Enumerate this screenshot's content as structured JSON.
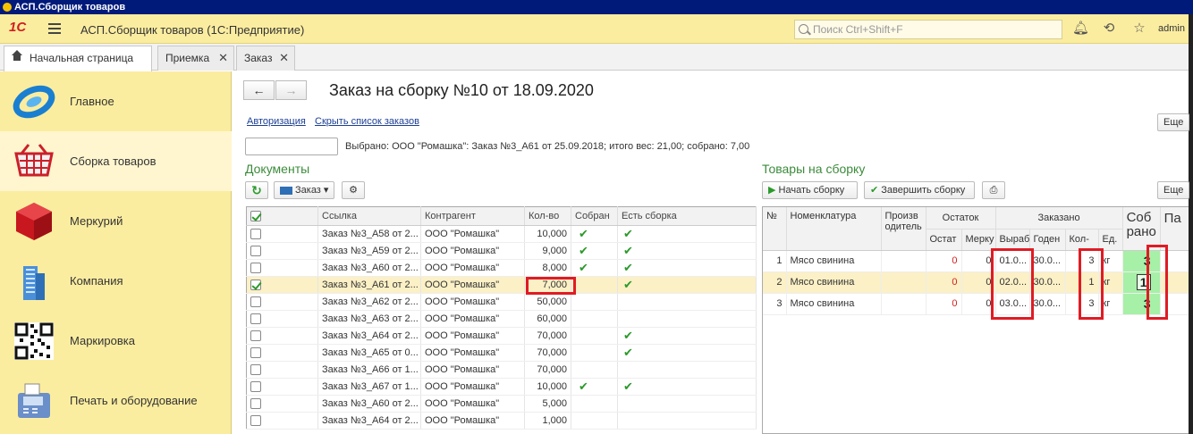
{
  "window": {
    "title": "АСП.Сборщик товаров"
  },
  "header": {
    "logo": "1С",
    "app_title": "АСП.Сборщик товаров  (1С:Предприятие)",
    "search_placeholder": "Поиск Ctrl+Shift+F",
    "user": "admin",
    "icons": [
      "bell-icon",
      "history-icon",
      "star-icon"
    ]
  },
  "tabs": [
    {
      "label": "Начальная страница",
      "active": true
    },
    {
      "label": "Приемка",
      "active": false
    },
    {
      "label": "Заказ",
      "active": false
    }
  ],
  "sidebar": {
    "items": [
      {
        "label": "Главное",
        "icon": "main-icon"
      },
      {
        "label": "Сборка товаров",
        "icon": "basket-icon",
        "active": true
      },
      {
        "label": "Меркурий",
        "icon": "cube-icon"
      },
      {
        "label": "Компания",
        "icon": "building-icon"
      },
      {
        "label": "Маркировка",
        "icon": "qr-code-icon"
      },
      {
        "label": "Печать и оборудование",
        "icon": "terminal-icon"
      }
    ]
  },
  "main": {
    "title": "Заказ на сборку №10 от 18.09.2020",
    "links": {
      "auth": "Авторизация",
      "hide_orders": "Скрыть список заказов"
    },
    "more_label": "Еще",
    "selected_info": "Выбрано: ООО \"Ромашка\": Заказ №3_А61 от 25.09.2018; итого вес: 21,00; собрано: 7,00",
    "documents": {
      "title": "Документы",
      "order_button": "Заказ",
      "columns": [
        "Ссылка",
        "Контрагент",
        "Кол-во",
        "Собран",
        "Есть сборка"
      ],
      "rows": [
        {
          "checked": false,
          "ref": "Заказ №3_А58 от 2...",
          "party": "ООО \"Ромашка\"",
          "qty": "10,000",
          "collected": true,
          "has_assembly": true
        },
        {
          "checked": false,
          "ref": "Заказ №3_А59 от 2...",
          "party": "ООО \"Ромашка\"",
          "qty": "9,000",
          "collected": true,
          "has_assembly": true
        },
        {
          "checked": false,
          "ref": "Заказ №3_А60 от 2...",
          "party": "ООО \"Ромашка\"",
          "qty": "8,000",
          "collected": true,
          "has_assembly": true
        },
        {
          "checked": true,
          "ref": "Заказ №3_А61 от 2...",
          "party": "ООО \"Ромашка\"",
          "qty": "7,000",
          "collected": false,
          "has_assembly": true,
          "selected": true
        },
        {
          "checked": false,
          "ref": "Заказ №3_А62 от 2...",
          "party": "ООО \"Ромашка\"",
          "qty": "50,000",
          "collected": false,
          "has_assembly": false
        },
        {
          "checked": false,
          "ref": "Заказ №3_А63 от 2...",
          "party": "ООО \"Ромашка\"",
          "qty": "60,000",
          "collected": false,
          "has_assembly": false
        },
        {
          "checked": false,
          "ref": "Заказ №3_А64 от 2...",
          "party": "ООО \"Ромашка\"",
          "qty": "70,000",
          "collected": false,
          "has_assembly": true
        },
        {
          "checked": false,
          "ref": "Заказ №3_А65 от 0...",
          "party": "ООО \"Ромашка\"",
          "qty": "70,000",
          "collected": false,
          "has_assembly": true
        },
        {
          "checked": false,
          "ref": "Заказ №3_А66 от 1...",
          "party": "ООО \"Ромашка\"",
          "qty": "70,000",
          "collected": false,
          "has_assembly": false
        },
        {
          "checked": false,
          "ref": "Заказ №3_А67 от 1...",
          "party": "ООО \"Ромашка\"",
          "qty": "10,000",
          "collected": true,
          "has_assembly": true
        },
        {
          "checked": false,
          "ref": "Заказ №3_А60 от 2...",
          "party": "ООО \"Ромашка\"",
          "qty": "5,000",
          "collected": false,
          "has_assembly": false
        },
        {
          "checked": false,
          "ref": "Заказ №3_А64 от 2...",
          "party": "ООО \"Ромашка\"",
          "qty": "1,000",
          "collected": false,
          "has_assembly": false
        }
      ]
    },
    "goods": {
      "title": "Товары на сборку",
      "start_button": "Начать сборку",
      "finish_button": "Завершить сборку",
      "headers": {
        "n": "№",
        "nomen": "Номенклатура",
        "producer": "Произв одитель",
        "stock": "Остаток",
        "ordered": "Заказано",
        "collected": "Соб рано",
        "pa": "Па",
        "stock_sub": [
          "Остат",
          "Мерку"
        ],
        "ordered_sub": [
          "Выраб",
          "Годен",
          "Кол-",
          "Ед."
        ]
      },
      "rows": [
        {
          "n": "1",
          "name": "Мясо свинина",
          "stock": "0",
          "merc": "0",
          "made": "01.0...",
          "valid": "30.0...",
          "qty": "3",
          "unit": "кг",
          "collected": "3"
        },
        {
          "n": "2",
          "name": "Мясо свинина",
          "stock": "0",
          "merc": "0",
          "made": "02.0...",
          "valid": "30.0...",
          "qty": "1",
          "unit": "кг",
          "collected": "1",
          "selected": true
        },
        {
          "n": "3",
          "name": "Мясо свинина",
          "stock": "0",
          "merc": "0",
          "made": "03.0...",
          "valid": "30.0...",
          "qty": "3",
          "unit": "кг",
          "collected": "3"
        }
      ]
    }
  }
}
